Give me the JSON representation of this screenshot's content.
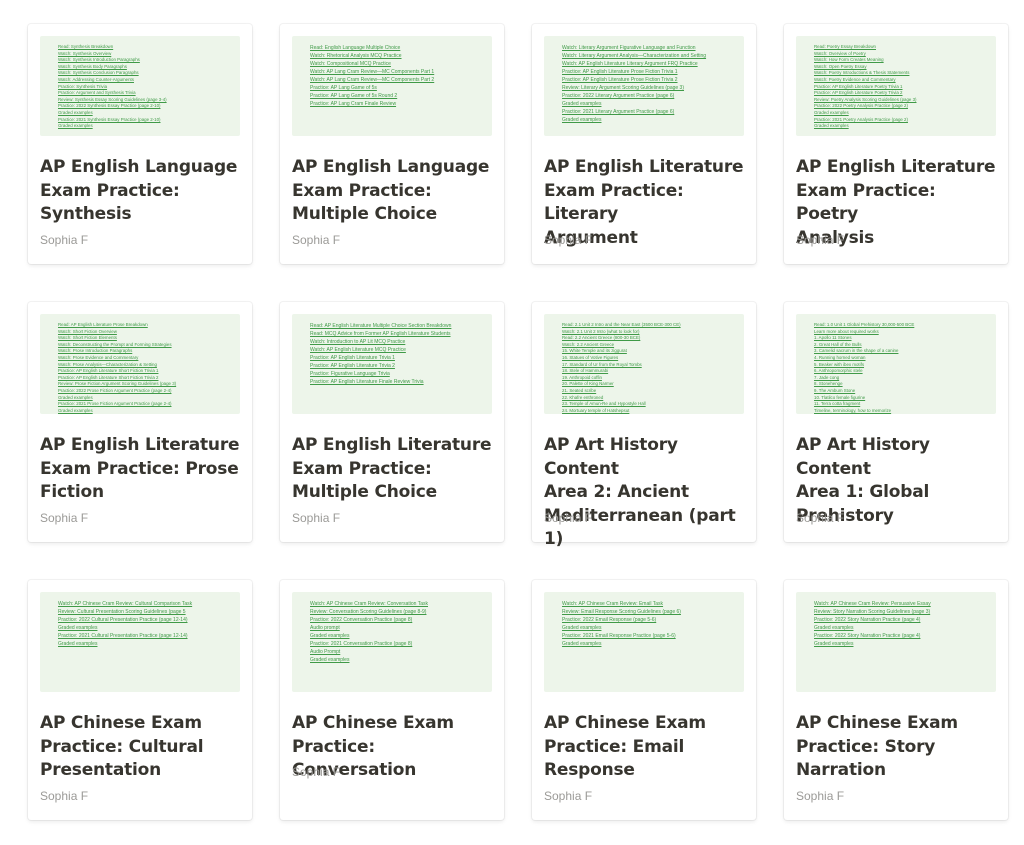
{
  "cards": [
    {
      "title_lines": [
        "AP English Language",
        "Exam Practice:",
        "Synthesis"
      ],
      "author": "Sophia F",
      "preview": [
        "Read: Synthesis Breakdown",
        "Watch: Synthesis Overview",
        "Watch: Synthesis Introduction Paragraphs",
        "Watch: Synthesis Body Paragraphs",
        "Watch: Synthesis Conclusion Paragraphs",
        "Watch: Addressing Counter-Arguments",
        "Practice: Synthesis Trivia",
        "Practice: Argument and Synthesis Trivia",
        "Review: Synthesis Essay Scoring Guidelines (page 3-4)",
        "Practice: 2022 Synthesis Essay Practice (page 2-10)",
        "Graded examples",
        "Practice: 2021 Synthesis Essay Practice (page 2-10)",
        "Graded examples"
      ]
    },
    {
      "title_lines": [
        "AP English Language",
        "Exam Practice:",
        "Multiple Choice"
      ],
      "author": "Sophia F",
      "preview": [
        "Read: English Language Multiple Choice",
        "Watch: Rhetorical Analysis MCQ Practice",
        "Watch: Compositional MCQ Practice",
        "Watch: AP Lang Cram Review—MC Components Part 1",
        "Watch: AP Lang Cram Review—MC Components Part 2",
        "Practice: AP Lang Game of 5s",
        "Practice: AP Lang Game of 5s Round 2",
        "Practice: AP Lang Cram Finale Review"
      ]
    },
    {
      "title_lines": [
        "AP English Literature",
        "Exam Practice: Literary",
        "Argument"
      ],
      "author": "Sophia F",
      "preview": [
        "Watch: Literary Argument Figurative Language and Function",
        "Watch: Literary Argument Analysis—Characterization and Setting",
        "Watch: AP English Literature Literary Argument FRQ Practice",
        "Practice: AP English Literature Prose Fiction Trivia 1",
        "Practice: AP English Literature Prose Fiction Trivia 2",
        "Review: Literary Argument Scoring Guidelines (page 3)",
        "Practice: 2022 Literary Argument Practice (page 6)",
        "Graded examples",
        "Practice: 2021 Literary Argument Practice (page 6)",
        "Graded examples"
      ]
    },
    {
      "title_lines": [
        "AP English Literature",
        "Exam Practice: Poetry",
        "Analysis"
      ],
      "author": "Sophia F",
      "preview": [
        "Read: Poetry Essay Breakdown",
        "Watch: Overview of Poetry",
        "Watch: How Form Creates Meaning",
        "Watch: Open Poetry Essay",
        "Watch: Poetry Introductions & Thesis Statements",
        "Watch: Poetry Evidence and Commentary",
        "Practice: AP English Literature Poetry Trivia 1",
        "Practice: AP English Literature Poetry Trivia 2",
        "Review: Poetry Analysis Scoring Guidelines (page 3)",
        "Practice: 2022 Poetry Analysis Practice (page 2)",
        "Graded examples",
        "Practice: 2021 Poetry Analysis Practice (page 2)",
        "Graded examples"
      ]
    },
    {
      "title_lines": [
        "AP English Literature",
        "Exam Practice: Prose",
        "Fiction"
      ],
      "author": "Sophia F",
      "preview": [
        "Read: AP English Literature Prose Breakdown",
        "Watch: Short Fiction Overview",
        "Watch: Short Fiction Elements",
        "Watch: Deconstructing the Prompt and Forming Strategies",
        "Watch: Prose Introduction Paragraphs",
        "Watch: Prose Evidence and Commentary",
        "Watch: Prose Analysis—Characterization & Setting",
        "Practice: AP English Literature Short Fiction Trivia 1",
        "Practice: AP English Literature Short Fiction Trivia 2",
        "Review: Prose Fiction Argument Scoring Guidelines (page 3)",
        "Practice: 2022 Prose Fiction Argument Practice (page 2-4)",
        "Graded examples",
        "Practice: 2021 Prose Fiction Argument Practice (page 2-4)",
        "Graded examples"
      ]
    },
    {
      "title_lines": [
        "AP English Literature",
        "Exam Practice:",
        "Multiple Choice"
      ],
      "author": "Sophia F",
      "preview": [
        "Read: AP English Literature Multiple Choice Section Breakdown",
        "Read: MCQ Advice from Former AP English Literature Students",
        "Watch: Introduction to AP Lit MCQ Practice",
        "Watch: AP English Literature MCQ Practice",
        "Practice: AP English Literature Trivia 1",
        "Practice: AP English Literature Trivia 2",
        "Practice: Figurative Language Trivia",
        "Practice: AP English Literature Finale Review Trivia"
      ]
    },
    {
      "title_lines": [
        "AP Art History Content",
        "Area 2: Ancient",
        "Mediterranean (part 1)"
      ],
      "author": "Sophia F",
      "preview": [
        "Read: 2.1 Unit 2 Intro and the Near East (3500 BCE-300 CE)",
        "Watch: 2.1 Unit 2 Intro (what to look for)",
        "Read: 2.2 Ancient Greece (800-30 BCE)",
        "Watch: 2.2 Ancient Greece",
        "15. White Temple and its ziggurat",
        "16. Statues of Votive Figures",
        "17. Standard of Ur from the Royal Tombs",
        "18. Stele of Hammurabi",
        "19. Anthropoid coffin",
        "20. Palette of King Narmer",
        "21. Seated scribe",
        "22. Khafre enthroned",
        "23. Temple of Amun-Re and Hypostyle Hall",
        "24. Mortuary temple of Hatshepsut",
        "25. Last judgment of Hu-Nefer",
        "26. Lamassu from the citadel of Sargon II",
        "Forbidden city",
        "Persepolis",
        "Pyramids of Giza",
        "Athenian agora",
        "Marcus Aurelius"
      ]
    },
    {
      "title_lines": [
        "AP Art History Content",
        "Area 1: Global",
        "Prehistory"
      ],
      "author": "Sophia F",
      "preview": [
        "Read: 1.0 Unit 1 Global Prehistory 30,000-500 BCE",
        "Learn more about required works",
        "1. Apollo 11 Stones",
        "2. Great Hall of the Bulls",
        "3. Camelid sacrum in the shape of a canine",
        "4. Running horned woman",
        "5. Beaker with ibex motifs",
        "6. Anthropomorphic stele",
        "7. Jade cong",
        "8. Stonehenge",
        "9. The Ambum Stone",
        "10. Tlatilco female figurine",
        "11. Terra cotta fragment",
        "Timeline, terminology, how to memorize",
        "Memorize: Required works in Content Area 1"
      ]
    },
    {
      "title_lines": [
        "AP Chinese Exam",
        "Practice: Cultural",
        "Presentation"
      ],
      "author": "Sophia F",
      "preview": [
        "Watch: AP Chinese Cram Review: Cultural Comparison Task",
        "Review: Cultural Presentation Scoring Guidelines (page 5",
        "Practice: 2022 Cultural Presentation Practice (page 12-14)",
        "Graded examples",
        "Practice: 2021 Cultural Presentation Practice (page 12-14)",
        "Graded examples"
      ]
    },
    {
      "title_lines": [
        "AP Chinese Exam",
        "Practice: Conversation"
      ],
      "author": "Sophia F",
      "preview": [
        "Watch: AP Chinese Cram Review: Conversation Task",
        "Review: Conversation Scoring Guidelines (page 8-9)",
        "Practice: 2022 Conversation Practice (page 8)",
        "Audio prompt",
        "Graded examples",
        "Practice: 2021 Conversation Practice (page 8)",
        "Audio Prompt",
        "Graded examples"
      ]
    },
    {
      "title_lines": [
        "AP Chinese Exam",
        "Practice: Email",
        "Response"
      ],
      "author": "Sophia F",
      "preview": [
        "Watch: AP Chinese Cram Review: Email Task",
        "Review: Email Response Scoring Guidelines (page 6)",
        "Practice: 2022 Email Response (page 5-6)",
        "Graded examples",
        "Practice: 2021 Email Response Practice (page 5-6)",
        "Graded examples"
      ]
    },
    {
      "title_lines": [
        "AP Chinese Exam",
        "Practice: Story",
        "Narration"
      ],
      "author": "Sophia F",
      "preview": [
        "Watch: AP Chinese Cram Review: Persuasive Essay",
        "Review: Story Narration Scoring Guidelines (page 3)",
        "Practice: 2022 Story Narration Practice (page 4)",
        "Graded examples",
        "Practice: 2022 Story Narration Practice (page 4)",
        "Graded examples"
      ]
    }
  ]
}
